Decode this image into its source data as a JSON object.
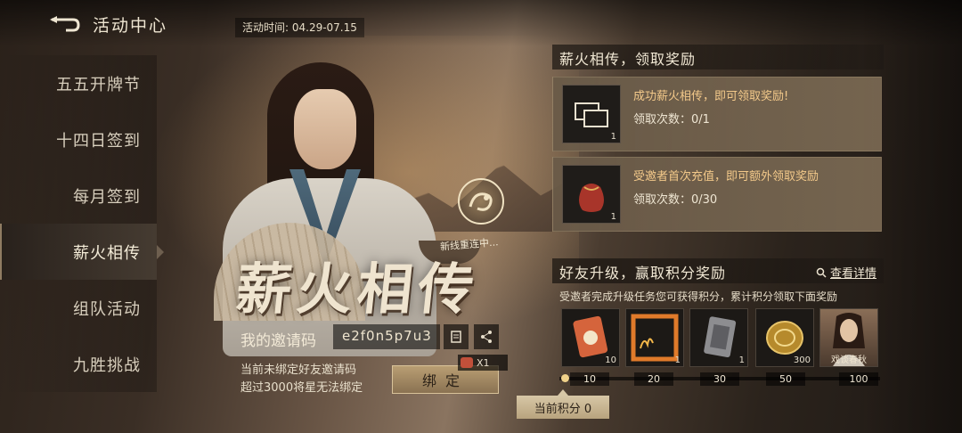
{
  "header": {
    "title": "活动中心",
    "period": "活动时间: 04.29-07.15"
  },
  "sidebar": {
    "items": [
      {
        "label": "五五开牌节",
        "active": false
      },
      {
        "label": "十四日签到",
        "active": false
      },
      {
        "label": "每月签到",
        "active": false
      },
      {
        "label": "薪火相传",
        "active": true
      },
      {
        "label": "组队活动",
        "active": false
      },
      {
        "label": "九胜挑战",
        "active": false
      }
    ]
  },
  "hero": {
    "big_title": "薪火相传",
    "emblem_caption": "新线重连中..."
  },
  "invite": {
    "label": "我的邀请码",
    "code": "e2f0n5p7u3",
    "note_line1": "当前未绑定好友邀请码",
    "note_line2": "超过3000将星无法绑定",
    "bind_label": "绑定",
    "bind_reward": "X1"
  },
  "section1": {
    "title": "薪火相传，领取奖励",
    "tasks": [
      {
        "title": "成功薪火相传，即可领取奖励!",
        "progress": "领取次数：0/1",
        "icon": "chat-bubbles-icon",
        "count": "1"
      },
      {
        "title": "受邀者首次充值，即可额外领取奖励",
        "progress": "领取次数：0/30",
        "icon": "red-pouch-icon",
        "count": "1"
      }
    ]
  },
  "section2": {
    "title": "好友升级，赢取积分奖励",
    "detail_link": "查看详情",
    "note": "受邀者完成升级任务您可获得积分，累计积分领取下面奖励",
    "rewards": [
      {
        "icon": "card-token-icon",
        "count": "10",
        "name": ""
      },
      {
        "icon": "flame-frame-icon",
        "count": "1",
        "name": ""
      },
      {
        "icon": "scroll-card-icon",
        "count": "1",
        "name": ""
      },
      {
        "icon": "gold-coin-icon",
        "count": "300",
        "name": ""
      },
      {
        "icon": "hero-portrait-icon",
        "count": "",
        "name": "戏谈春秋"
      }
    ],
    "milestones": [
      "10",
      "20",
      "30",
      "50",
      "100"
    ],
    "current_score_label": "当前积分 0",
    "progress": 0
  },
  "colors": {
    "accent_gold": "#c9a35e",
    "task_title": "#f3c98a"
  }
}
